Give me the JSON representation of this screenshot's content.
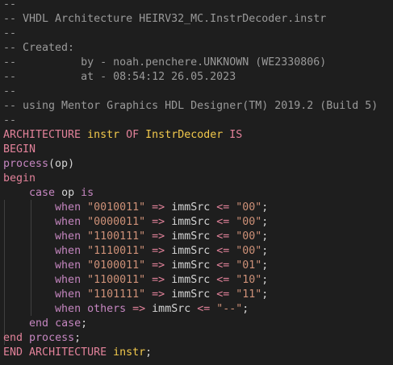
{
  "editor": {
    "language": "VHDL",
    "colors": {
      "background": "#1e1e1e",
      "comment": "#9a9a9a",
      "keyword_pink": "#e2829a",
      "keyword_purple": "#c586c0",
      "identifier": "#f2c94c",
      "string": "#ce9178",
      "text": "#d4d4d4"
    },
    "lines": [
      {
        "type": "comment",
        "text": "--"
      },
      {
        "type": "comment",
        "text": "-- VHDL Architecture HEIRV32_MC.InstrDecoder.instr"
      },
      {
        "type": "comment",
        "text": "--"
      },
      {
        "type": "comment",
        "text": "-- Created:"
      },
      {
        "type": "comment",
        "text": "--          by - noah.penchere.UNKNOWN (WE2330806)"
      },
      {
        "type": "comment",
        "text": "--          at - 08:54:12 26.05.2023"
      },
      {
        "type": "comment",
        "text": "--"
      },
      {
        "type": "comment",
        "text": "-- using Mentor Graphics HDL Designer(TM) 2019.2 (Build 5)"
      },
      {
        "type": "comment",
        "text": "--"
      },
      {
        "type": "code",
        "tokens": [
          {
            "kind": "kw-pink",
            "text": "ARCHITECTURE"
          },
          {
            "kind": "plain",
            "text": " "
          },
          {
            "kind": "ident",
            "text": "instr"
          },
          {
            "kind": "plain",
            "text": " "
          },
          {
            "kind": "kw-pink",
            "text": "OF"
          },
          {
            "kind": "plain",
            "text": " "
          },
          {
            "kind": "ident",
            "text": "InstrDecoder"
          },
          {
            "kind": "plain",
            "text": " "
          },
          {
            "kind": "kw-pink",
            "text": "IS"
          }
        ]
      },
      {
        "type": "code",
        "tokens": [
          {
            "kind": "kw-pink",
            "text": "BEGIN"
          }
        ]
      },
      {
        "type": "code",
        "tokens": [
          {
            "kind": "kw-purple",
            "text": "process"
          },
          {
            "kind": "plain",
            "text": "(op)"
          }
        ]
      },
      {
        "type": "code",
        "tokens": [
          {
            "kind": "kw-pink",
            "text": "begin"
          }
        ]
      },
      {
        "type": "code",
        "tokens": [
          {
            "kind": "plain",
            "text": "    "
          },
          {
            "kind": "kw-purple",
            "text": "case"
          },
          {
            "kind": "plain",
            "text": " op "
          },
          {
            "kind": "kw-purple",
            "text": "is"
          }
        ]
      },
      {
        "type": "code",
        "tokens": [
          {
            "kind": "plain",
            "text": "        "
          },
          {
            "kind": "kw-purple",
            "text": "when"
          },
          {
            "kind": "plain",
            "text": " "
          },
          {
            "kind": "string",
            "text": "\"0010011\""
          },
          {
            "kind": "plain",
            "text": " "
          },
          {
            "kind": "operator",
            "text": "=>"
          },
          {
            "kind": "plain",
            "text": " immSrc "
          },
          {
            "kind": "operator",
            "text": "<="
          },
          {
            "kind": "plain",
            "text": " "
          },
          {
            "kind": "string",
            "text": "\"00\""
          },
          {
            "kind": "plain",
            "text": ";"
          }
        ]
      },
      {
        "type": "code",
        "tokens": [
          {
            "kind": "plain",
            "text": "        "
          },
          {
            "kind": "kw-purple",
            "text": "when"
          },
          {
            "kind": "plain",
            "text": " "
          },
          {
            "kind": "string",
            "text": "\"0000011\""
          },
          {
            "kind": "plain",
            "text": " "
          },
          {
            "kind": "operator",
            "text": "=>"
          },
          {
            "kind": "plain",
            "text": " immSrc "
          },
          {
            "kind": "operator",
            "text": "<="
          },
          {
            "kind": "plain",
            "text": " "
          },
          {
            "kind": "string",
            "text": "\"00\""
          },
          {
            "kind": "plain",
            "text": ";"
          }
        ]
      },
      {
        "type": "code",
        "tokens": [
          {
            "kind": "plain",
            "text": "        "
          },
          {
            "kind": "kw-purple",
            "text": "when"
          },
          {
            "kind": "plain",
            "text": " "
          },
          {
            "kind": "string",
            "text": "\"1100111\""
          },
          {
            "kind": "plain",
            "text": " "
          },
          {
            "kind": "operator",
            "text": "=>"
          },
          {
            "kind": "plain",
            "text": " immSrc "
          },
          {
            "kind": "operator",
            "text": "<="
          },
          {
            "kind": "plain",
            "text": " "
          },
          {
            "kind": "string",
            "text": "\"00\""
          },
          {
            "kind": "plain",
            "text": ";"
          }
        ]
      },
      {
        "type": "code",
        "tokens": [
          {
            "kind": "plain",
            "text": "        "
          },
          {
            "kind": "kw-purple",
            "text": "when"
          },
          {
            "kind": "plain",
            "text": " "
          },
          {
            "kind": "string",
            "text": "\"1110011\""
          },
          {
            "kind": "plain",
            "text": " "
          },
          {
            "kind": "operator",
            "text": "=>"
          },
          {
            "kind": "plain",
            "text": " immSrc "
          },
          {
            "kind": "operator",
            "text": "<="
          },
          {
            "kind": "plain",
            "text": " "
          },
          {
            "kind": "string",
            "text": "\"00\""
          },
          {
            "kind": "plain",
            "text": ";"
          }
        ]
      },
      {
        "type": "code",
        "tokens": [
          {
            "kind": "plain",
            "text": "        "
          },
          {
            "kind": "kw-purple",
            "text": "when"
          },
          {
            "kind": "plain",
            "text": " "
          },
          {
            "kind": "string",
            "text": "\"0100011\""
          },
          {
            "kind": "plain",
            "text": " "
          },
          {
            "kind": "operator",
            "text": "=>"
          },
          {
            "kind": "plain",
            "text": " immSrc "
          },
          {
            "kind": "operator",
            "text": "<="
          },
          {
            "kind": "plain",
            "text": " "
          },
          {
            "kind": "string",
            "text": "\"01\""
          },
          {
            "kind": "plain",
            "text": ";"
          }
        ]
      },
      {
        "type": "code",
        "tokens": [
          {
            "kind": "plain",
            "text": "        "
          },
          {
            "kind": "kw-purple",
            "text": "when"
          },
          {
            "kind": "plain",
            "text": " "
          },
          {
            "kind": "string",
            "text": "\"1100011\""
          },
          {
            "kind": "plain",
            "text": " "
          },
          {
            "kind": "operator",
            "text": "=>"
          },
          {
            "kind": "plain",
            "text": " immSrc "
          },
          {
            "kind": "operator",
            "text": "<="
          },
          {
            "kind": "plain",
            "text": " "
          },
          {
            "kind": "string",
            "text": "\"10\""
          },
          {
            "kind": "plain",
            "text": ";"
          }
        ]
      },
      {
        "type": "code",
        "tokens": [
          {
            "kind": "plain",
            "text": "        "
          },
          {
            "kind": "kw-purple",
            "text": "when"
          },
          {
            "kind": "plain",
            "text": " "
          },
          {
            "kind": "string",
            "text": "\"1101111\""
          },
          {
            "kind": "plain",
            "text": " "
          },
          {
            "kind": "operator",
            "text": "=>"
          },
          {
            "kind": "plain",
            "text": " immSrc "
          },
          {
            "kind": "operator",
            "text": "<="
          },
          {
            "kind": "plain",
            "text": " "
          },
          {
            "kind": "string",
            "text": "\"11\""
          },
          {
            "kind": "plain",
            "text": ";"
          }
        ]
      },
      {
        "type": "code",
        "tokens": [
          {
            "kind": "plain",
            "text": "        "
          },
          {
            "kind": "kw-purple",
            "text": "when"
          },
          {
            "kind": "plain",
            "text": " "
          },
          {
            "kind": "kw-purple",
            "text": "others"
          },
          {
            "kind": "plain",
            "text": " "
          },
          {
            "kind": "operator",
            "text": "=>"
          },
          {
            "kind": "plain",
            "text": " immSrc "
          },
          {
            "kind": "operator",
            "text": "<="
          },
          {
            "kind": "plain",
            "text": " "
          },
          {
            "kind": "string",
            "text": "\"--\""
          },
          {
            "kind": "plain",
            "text": ";"
          }
        ]
      },
      {
        "type": "code",
        "tokens": [
          {
            "kind": "plain",
            "text": "    "
          },
          {
            "kind": "kw-purple",
            "text": "end"
          },
          {
            "kind": "plain",
            "text": " "
          },
          {
            "kind": "kw-purple",
            "text": "case"
          },
          {
            "kind": "plain",
            "text": ";"
          }
        ]
      },
      {
        "type": "code",
        "tokens": [
          {
            "kind": "kw-pink",
            "text": "end"
          },
          {
            "kind": "plain",
            "text": " "
          },
          {
            "kind": "kw-purple",
            "text": "process"
          },
          {
            "kind": "plain",
            "text": ";"
          }
        ]
      },
      {
        "type": "code",
        "tokens": [
          {
            "kind": "kw-pink",
            "text": "END"
          },
          {
            "kind": "plain",
            "text": " "
          },
          {
            "kind": "kw-pink",
            "text": "ARCHITECTURE"
          },
          {
            "kind": "plain",
            "text": " "
          },
          {
            "kind": "ident",
            "text": "instr"
          },
          {
            "kind": "plain",
            "text": ";"
          }
        ]
      }
    ]
  }
}
